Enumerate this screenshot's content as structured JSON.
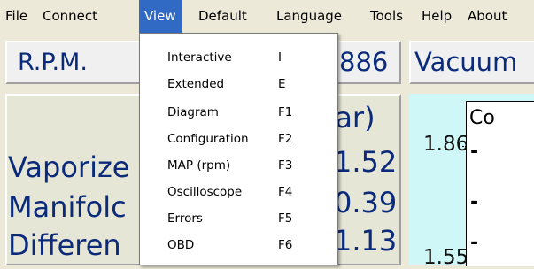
{
  "menubar": {
    "items": [
      {
        "label": "File"
      },
      {
        "label": "Connect"
      },
      {
        "label": "View"
      },
      {
        "label": "Default"
      },
      {
        "label": "Language"
      },
      {
        "label": "Tools"
      },
      {
        "label": "Help"
      },
      {
        "label": "About"
      }
    ]
  },
  "view_menu": {
    "items": [
      {
        "label": "Interactive",
        "shortcut": "I"
      },
      {
        "label": "Extended",
        "shortcut": "E"
      },
      {
        "label": "Diagram",
        "shortcut": "F1"
      },
      {
        "label": "Configuration",
        "shortcut": "F2"
      },
      {
        "label": "MAP (rpm)",
        "shortcut": "F3"
      },
      {
        "label": "Oscilloscope",
        "shortcut": "F4"
      },
      {
        "label": "Errors",
        "shortcut": "F5"
      },
      {
        "label": "OBD",
        "shortcut": "F6"
      }
    ]
  },
  "rpm": {
    "label": "R.P.M.",
    "value": "886"
  },
  "pressure": {
    "unit": "bar)",
    "rows": [
      {
        "label": "Vaporize",
        "value": "1.52"
      },
      {
        "label": "Manifolc",
        "value": "0.39"
      },
      {
        "label": "Differen",
        "value": "1.13"
      }
    ]
  },
  "vacuum": {
    "title": "Vacuum",
    "value_top": "1.86",
    "value_bottom": "1.55",
    "box_label": "Co",
    "dashes": [
      "-",
      "-",
      "-"
    ]
  },
  "colors": {
    "menu_highlight": "#316ac5",
    "value_text": "#0b2a7a",
    "vacuum_bg": "#cff7f7",
    "window_bg": "#ece9d8"
  }
}
